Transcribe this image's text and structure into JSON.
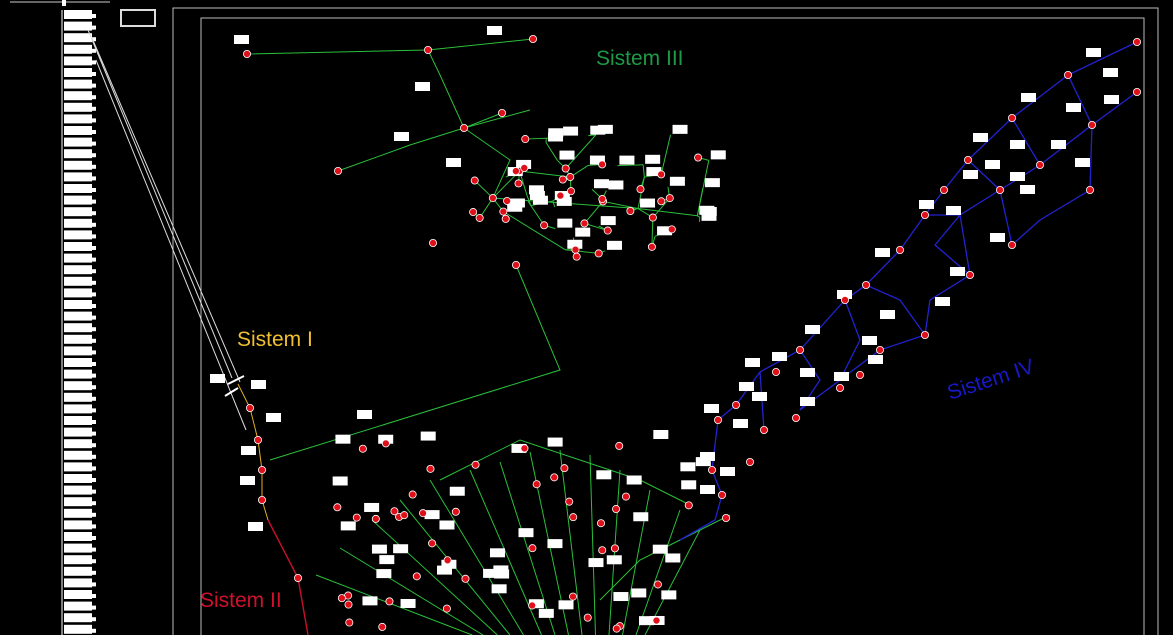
{
  "labels": {
    "sistem_1": "Sistem I",
    "sistem_2": "Sistem II",
    "sistem_3": "Sistem III",
    "sistem_4": "Sistem IV"
  },
  "colors": {
    "background": "#000000",
    "frame": "#c8c8c8",
    "sistem_1": "#f0c030",
    "sistem_2": "#d0102c",
    "sistem_3": "#1e9a46",
    "sistem_4": "#1818c8",
    "pipe_green": "#2bbf3a",
    "pipe_blue": "#2222d0",
    "pipe_red": "#c8102a",
    "pipe_yellow": "#e0b020",
    "node_red": "#e0101a",
    "box": "#ffffff"
  }
}
